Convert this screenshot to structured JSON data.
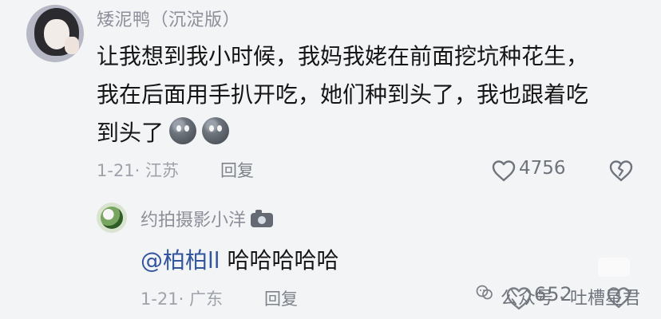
{
  "main_comment": {
    "username": "矮泥鸭（沉淀版）",
    "lines": [
      "让我想到我小时候，我妈我姥在前面挖坑种花生，",
      "我在后面用手扒开吃，她们种到头了，我也跟着吃",
      "到头了"
    ],
    "emoji_names": [
      "dizzy-face-emoji",
      "dizzy-face-emoji"
    ],
    "meta": "1-21· 江苏",
    "reply_label": "回复",
    "like_count": "4756"
  },
  "reply_comment": {
    "username": "约拍摄影小洋",
    "mention": "@柏柏ll",
    "text": " 哈哈哈哈哈",
    "meta": "1-21· 广东",
    "reply_label": "回复",
    "like_count": "652"
  },
  "watermark": {
    "text": "公众号 · 吐槽星君"
  },
  "icons": {
    "like": "heart-outline-icon",
    "dislike": "broken-heart-icon",
    "camera": "camera-icon",
    "watermark": "wechat-logo-icon"
  }
}
